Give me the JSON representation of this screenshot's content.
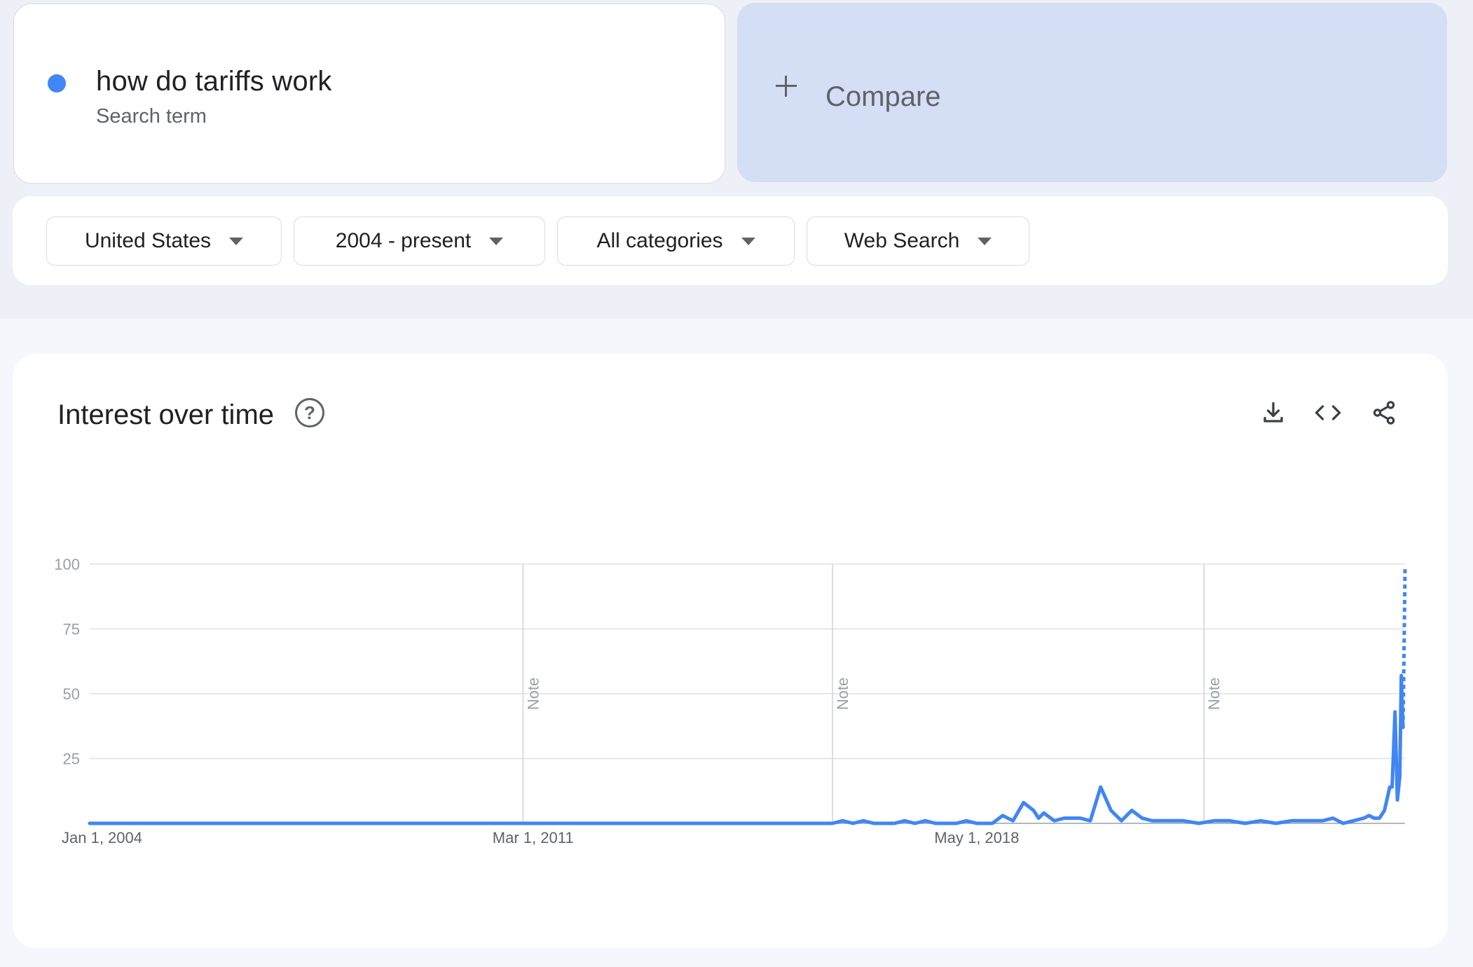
{
  "term": {
    "label": "how do tariffs work",
    "sublabel": "Search term",
    "dot_color": "#4285f4"
  },
  "compare": {
    "label": "Compare",
    "icon": "plus-icon",
    "bg_color": "#d4def5"
  },
  "filters": [
    {
      "label": "United States",
      "icon": "caret-down-icon"
    },
    {
      "label": "2004 - present",
      "icon": "caret-down-icon"
    },
    {
      "label": "All categories",
      "icon": "caret-down-icon"
    },
    {
      "label": "Web Search",
      "icon": "caret-down-icon"
    }
  ],
  "chart_card": {
    "title": "Interest over time",
    "help_icon": "help-circle-icon",
    "tools": [
      "download-icon",
      "embed-code-icon",
      "share-icon"
    ]
  },
  "chart_data": {
    "type": "line",
    "title": "Interest over time",
    "xlabel": "",
    "ylabel": "",
    "ylim": [
      0,
      100
    ],
    "xlim": [
      "2004-01-01",
      "2025-04-01"
    ],
    "yticks": [
      25,
      50,
      75,
      100
    ],
    "xticks": [
      {
        "label": "Jan 1, 2004",
        "date": "2004-01-01"
      },
      {
        "label": "Mar 1, 2011",
        "date": "2011-03-01"
      },
      {
        "label": "May 1, 2018",
        "date": "2018-05-01"
      }
    ],
    "notes": [
      {
        "label": "Note",
        "date": "2011-01-01"
      },
      {
        "label": "Note",
        "date": "2016-01-01"
      },
      {
        "label": "Note",
        "date": "2022-01-01"
      }
    ],
    "grid": true,
    "legend": "none",
    "line_color": "#4285f4",
    "series": [
      {
        "points": [
          [
            "2004-01-01",
            0
          ],
          [
            "2016-01-01",
            0
          ],
          [
            "2016-03-01",
            1
          ],
          [
            "2016-05-01",
            0
          ],
          [
            "2016-07-01",
            1
          ],
          [
            "2016-09-01",
            0
          ],
          [
            "2017-01-01",
            0
          ],
          [
            "2017-03-01",
            1
          ],
          [
            "2017-05-01",
            0
          ],
          [
            "2017-07-01",
            1
          ],
          [
            "2017-09-01",
            0
          ],
          [
            "2018-01-01",
            0
          ],
          [
            "2018-03-01",
            1
          ],
          [
            "2018-05-01",
            0
          ],
          [
            "2018-08-01",
            0
          ],
          [
            "2018-10-01",
            3
          ],
          [
            "2018-12-01",
            1
          ],
          [
            "2019-02-01",
            8
          ],
          [
            "2019-04-01",
            5
          ],
          [
            "2019-05-01",
            2
          ],
          [
            "2019-06-01",
            4
          ],
          [
            "2019-08-01",
            1
          ],
          [
            "2019-10-01",
            2
          ],
          [
            "2020-01-01",
            2
          ],
          [
            "2020-03-01",
            1
          ],
          [
            "2020-05-01",
            14
          ],
          [
            "2020-07-01",
            5
          ],
          [
            "2020-09-01",
            1
          ],
          [
            "2020-11-01",
            5
          ],
          [
            "2021-01-01",
            2
          ],
          [
            "2021-03-01",
            1
          ],
          [
            "2021-06-01",
            1
          ],
          [
            "2021-09-01",
            1
          ],
          [
            "2021-12-01",
            0
          ],
          [
            "2022-03-01",
            1
          ],
          [
            "2022-06-01",
            1
          ],
          [
            "2022-09-01",
            0
          ],
          [
            "2022-12-01",
            1
          ],
          [
            "2023-03-01",
            0
          ],
          [
            "2023-06-01",
            1
          ],
          [
            "2023-09-01",
            1
          ],
          [
            "2023-12-01",
            1
          ],
          [
            "2024-02-01",
            2
          ],
          [
            "2024-04-01",
            0
          ],
          [
            "2024-06-01",
            1
          ],
          [
            "2024-08-01",
            2
          ],
          [
            "2024-09-01",
            3
          ],
          [
            "2024-10-01",
            2
          ],
          [
            "2024-11-01",
            2
          ],
          [
            "2024-12-01",
            5
          ],
          [
            "2025-01-01",
            14
          ],
          [
            "2025-01-15",
            14
          ],
          [
            "2025-02-01",
            43
          ],
          [
            "2025-02-15",
            9
          ],
          [
            "2025-03-01",
            18
          ],
          [
            "2025-03-10",
            57
          ],
          [
            "2025-03-20",
            37
          ]
        ],
        "partial_points": [
          [
            "2025-03-20",
            37
          ],
          [
            "2025-03-25",
            60
          ],
          [
            "2025-04-01",
            98
          ]
        ]
      }
    ]
  }
}
